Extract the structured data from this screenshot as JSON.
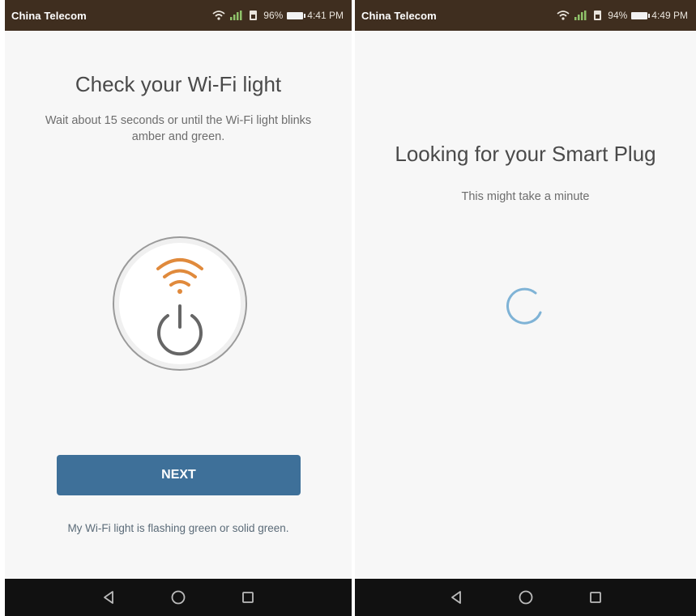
{
  "left": {
    "statusbar": {
      "carrier": "China Telecom",
      "battery": "96%",
      "time": "4:41 PM"
    },
    "title": "Check your Wi-Fi light",
    "subtitle": "Wait about 15 seconds or until the Wi-Fi light blinks amber and green.",
    "plug_icon": "smart-plug-wifi-power-icon",
    "next_label": "NEXT",
    "helper_link": "My Wi-Fi light is flashing green or solid green.",
    "colors": {
      "accent": "#3e7099",
      "wifi": "#e08a3c"
    }
  },
  "right": {
    "statusbar": {
      "carrier": "China Telecom",
      "battery": "94%",
      "time": "4:49 PM"
    },
    "title": "Looking for your Smart Plug",
    "subtitle": "This might take a minute",
    "spinner_icon": "loading-spinner-icon"
  },
  "navbar": {
    "icons": [
      "back-icon",
      "home-icon",
      "recents-icon"
    ]
  }
}
